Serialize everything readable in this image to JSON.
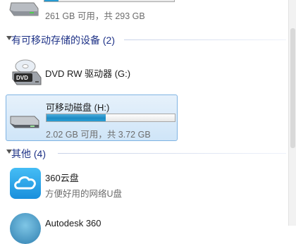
{
  "top_drive": {
    "space_text": "261 GB 可用，共 293 GB",
    "used_fraction": 0.11
  },
  "groups": {
    "removable": {
      "title": "有可移动存储的设备 (2)"
    },
    "other": {
      "title": "其他 (4)"
    }
  },
  "devices": {
    "dvd": {
      "name": "DVD RW 驱动器 (G:)"
    },
    "removable_disk": {
      "name": "可移动磁盘 (H:)",
      "space_text": "2.02 GB 可用，共 3.72 GB",
      "used_fraction": 0.46
    }
  },
  "apps": {
    "cloud360": {
      "name": "360云盘",
      "desc": "方便好用的网络U盘"
    },
    "autodesk": {
      "name": "Autodesk 360"
    }
  },
  "colors": {
    "group_title": "#1e3287",
    "bar_fill": "#1d8ac3",
    "selection": "#cfe5f8",
    "cloud_icon": "#2aa6ea"
  }
}
